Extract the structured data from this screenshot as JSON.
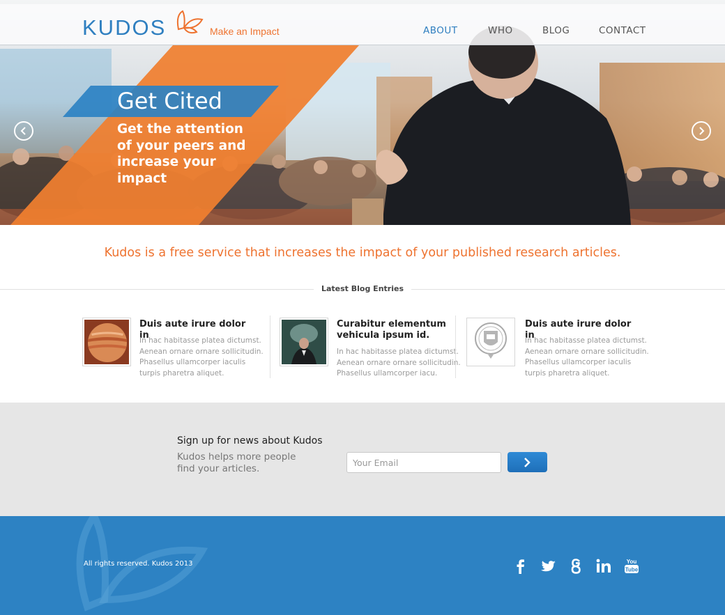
{
  "header": {
    "brand": "KUDOS",
    "tagline": "Make an Impact",
    "nav": [
      "ABOUT",
      "WHO",
      "BLOG",
      "CONTACT"
    ],
    "active_nav": "ABOUT"
  },
  "hero": {
    "title": "Get Cited",
    "body": "Get the attention of your peers and increase your impact"
  },
  "intro": "Kudos is a free service that increases the impact of your published research articles.",
  "blog": {
    "heading": "Latest Blog Entries",
    "posts": [
      {
        "title": "Duis aute irure dolor in",
        "body": "In hac habitasse platea dictumst. Aenean ornare ornare sollicitudin. Phasellus ullamcorper iaculis turpis pharetra aliquet."
      },
      {
        "title": "Curabitur elementum vehicula ipsum id.",
        "body": "In hac habitasse platea dictumst. Aenean ornare ornare sollicitudin. Phasellus ullamcorper iacu."
      },
      {
        "title": "Duis aute irure dolor in",
        "body": "In hac habitasse platea dictumst. Aenean ornare ornare sollicitudin. Phasellus ullamcorper iaculis turpis pharetra aliquet."
      }
    ]
  },
  "signup": {
    "title": "Sign up for news about Kudos",
    "description": "Kudos helps more people find your articles.",
    "email_placeholder": "Your Email"
  },
  "footer": {
    "copyright": "All rights reserved. Kudos 2013",
    "social": [
      "facebook-icon",
      "twitter-icon",
      "google-icon",
      "linkedin-icon",
      "youtube-icon"
    ]
  },
  "colors": {
    "brand_blue": "#2f7fc0",
    "brand_orange": "#ee7330",
    "footer_blue": "#2d82c3"
  }
}
